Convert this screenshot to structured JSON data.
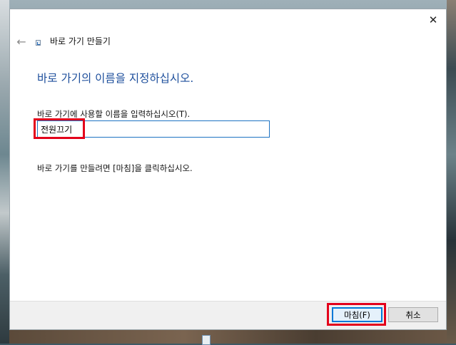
{
  "window": {
    "title": "바로 가기 만들기",
    "close_glyph": "✕",
    "back_glyph": "←"
  },
  "heading": "바로 가기의 이름을 지정하십시오.",
  "name_field": {
    "label": "바로 가기에 사용할 이름을 입력하십시오(T).",
    "value": "전원끄기"
  },
  "instruction": "바로 가기를 만들려면 [마침]을 클릭하십시오.",
  "buttons": {
    "finish": "마침(F)",
    "cancel": "취소"
  },
  "colors": {
    "heading": "#1e4f9c",
    "highlight": "#e3001b",
    "accent": "#0078d7"
  },
  "icons": [
    "close-icon",
    "back-arrow-icon",
    "shortcut-icon"
  ]
}
